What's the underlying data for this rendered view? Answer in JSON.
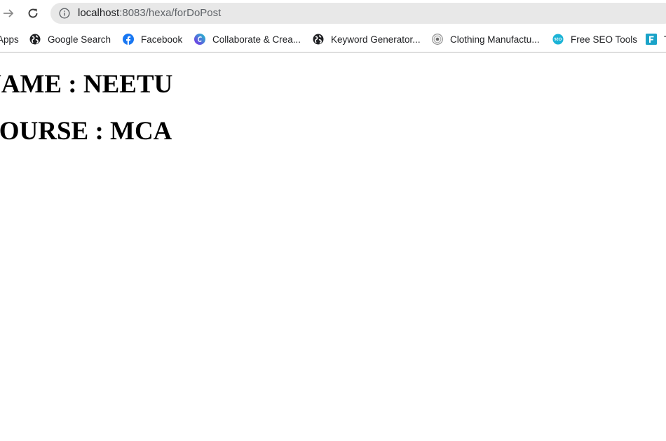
{
  "browser": {
    "url_host": "localhost",
    "url_path": ":8083/hexa/forDoPost",
    "icons": {
      "forward": "arrow-right-icon",
      "reload": "reload-icon",
      "site_info": "info-icon"
    }
  },
  "bookmarks": [
    {
      "label": "Apps",
      "icon": "apps-grid-icon"
    },
    {
      "label": "Google Search",
      "icon": "globe-icon"
    },
    {
      "label": "Facebook",
      "icon": "facebook-icon"
    },
    {
      "label": "Collaborate & Crea...",
      "icon": "canva-icon"
    },
    {
      "label": "Keyword Generator...",
      "icon": "globe-icon"
    },
    {
      "label": "Clothing Manufactu...",
      "icon": "seal-icon"
    },
    {
      "label": "Free SEO Tools",
      "icon": "seo-icon"
    },
    {
      "label": "T",
      "icon": "f-square-icon"
    }
  ],
  "page": {
    "name_heading": "NAME : NEETU",
    "course_heading": "COURSE : MCA"
  },
  "colors": {
    "omnibox_bg": "#e8e8e8",
    "facebook_blue": "#1877f2",
    "canva_purple": "#7d2ae8",
    "seo_teal": "#1bb3d6",
    "f_icon_teal": "#1aa3c8"
  }
}
